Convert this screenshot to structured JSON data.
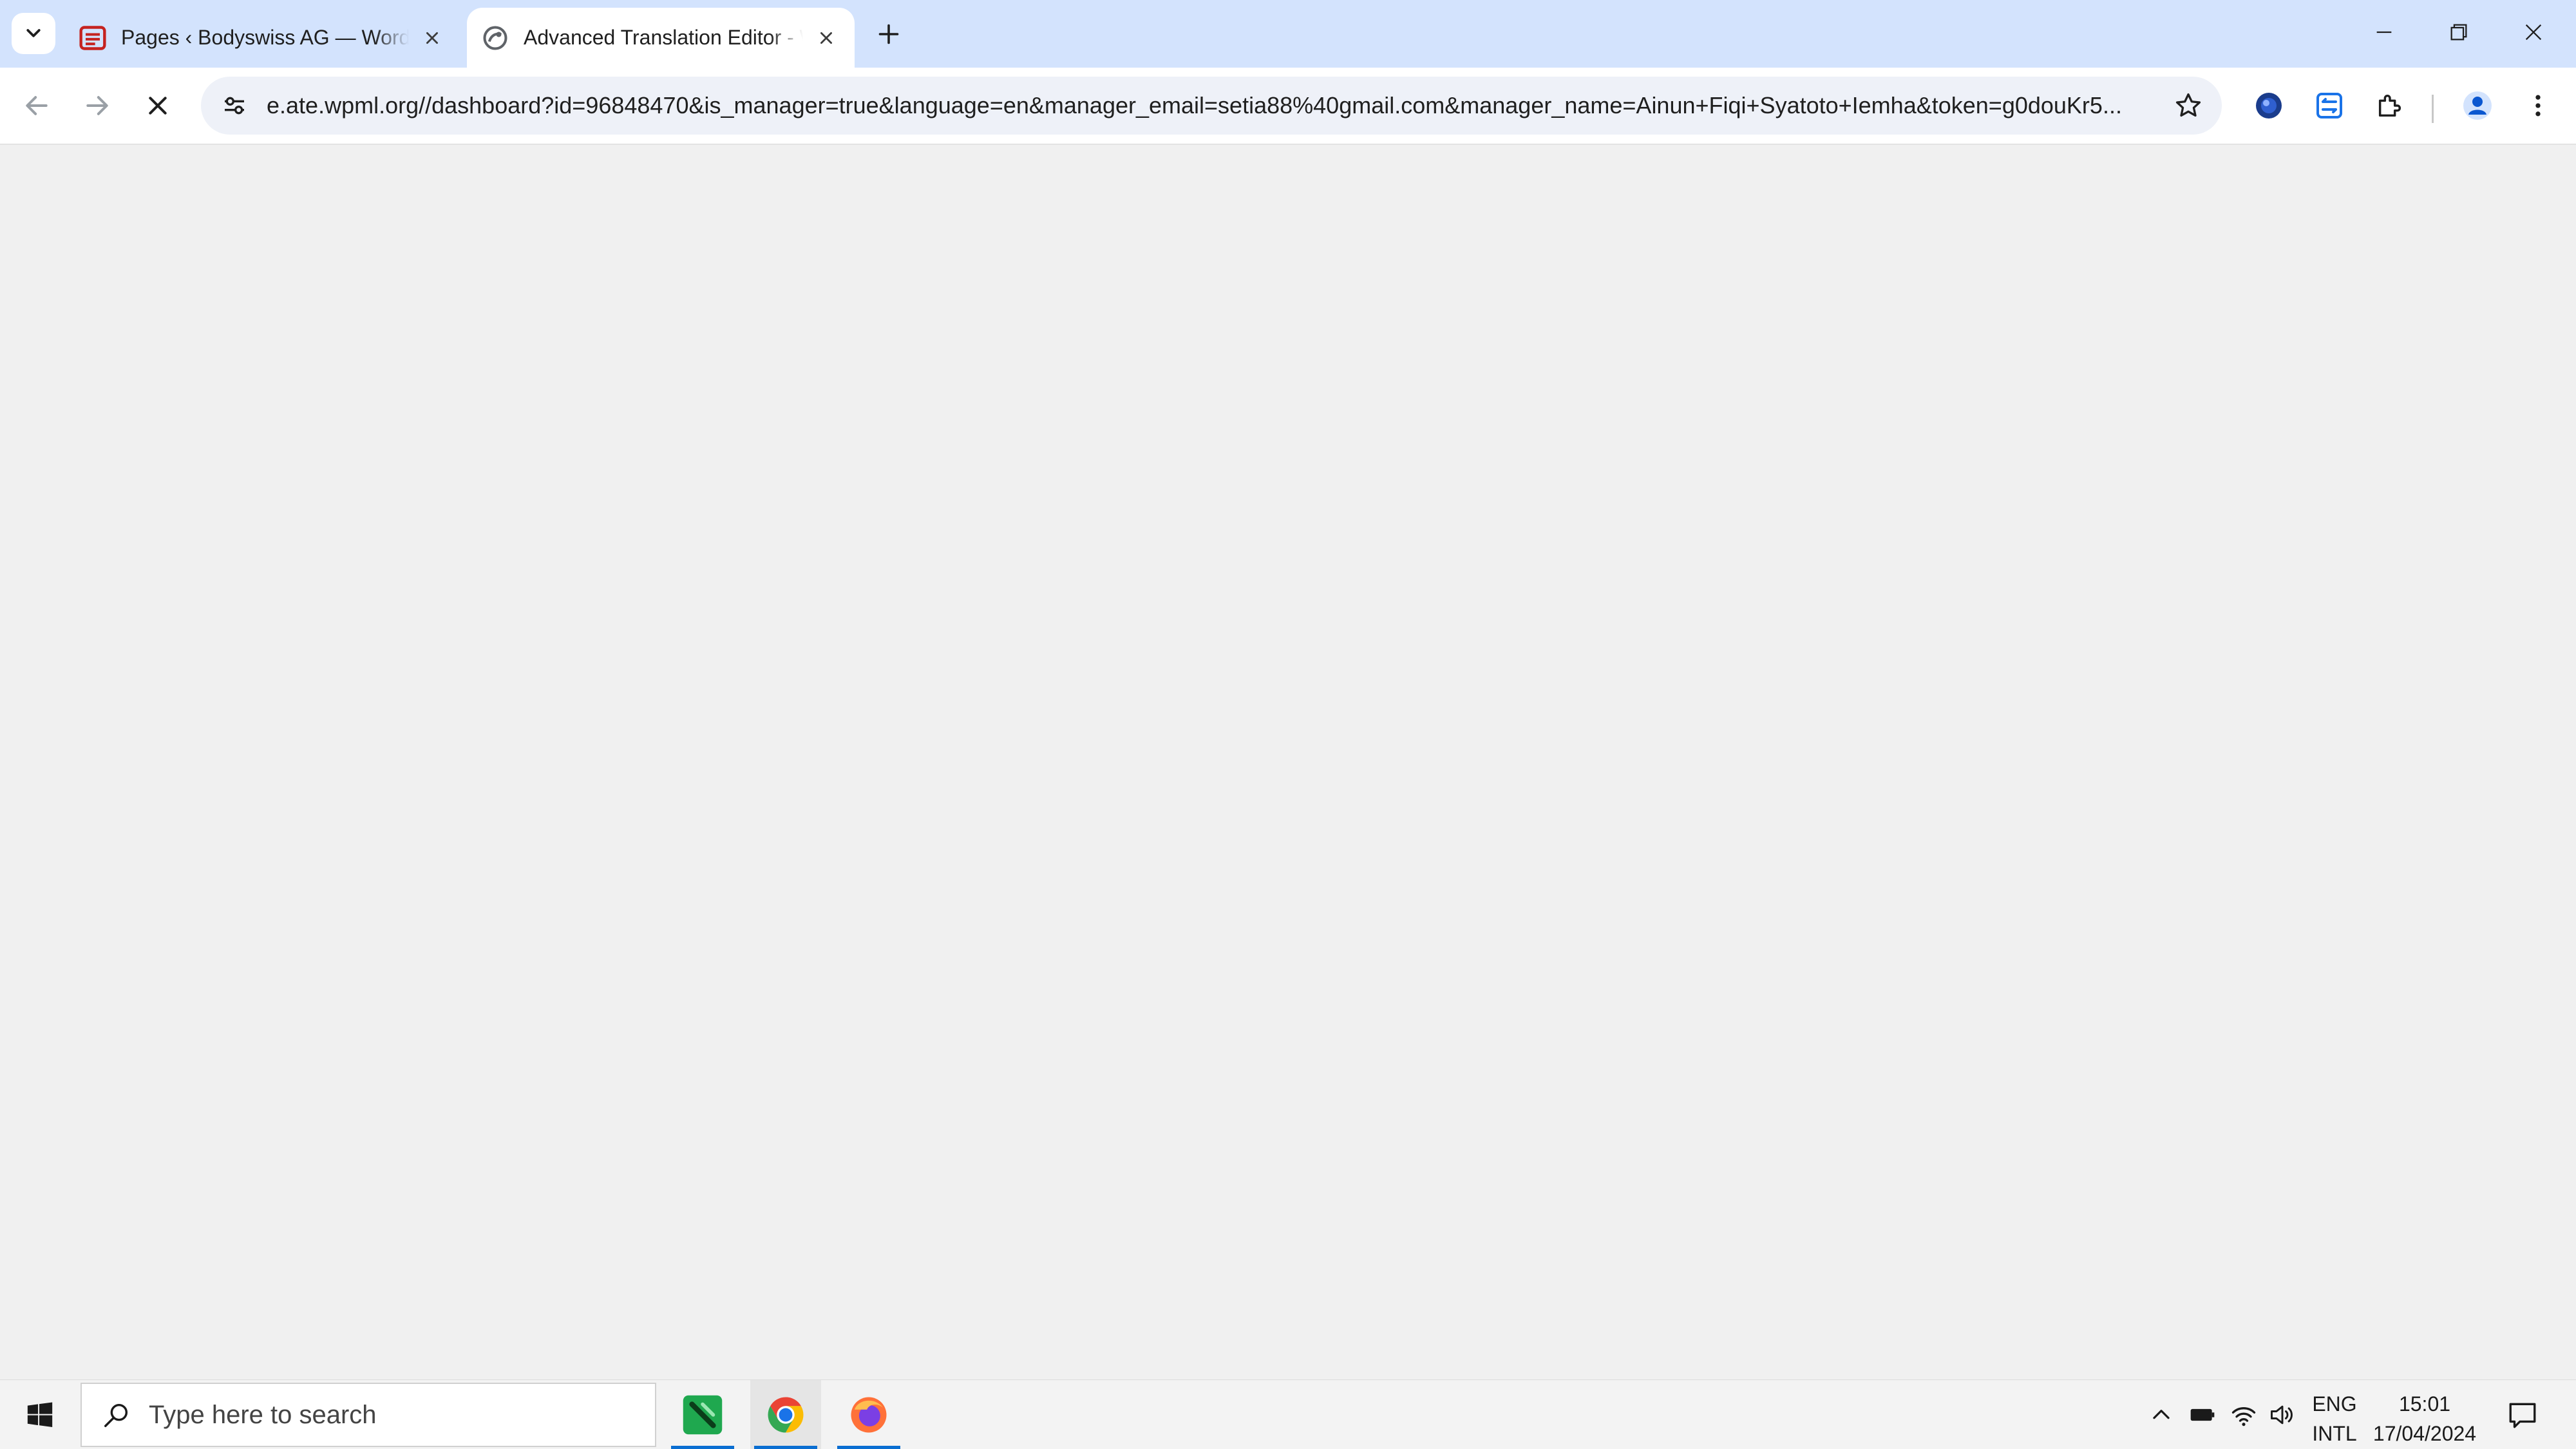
{
  "browser": {
    "tabs": [
      {
        "title": "Pages ‹ Bodyswiss AG — WordPress",
        "favicon": "wordpress-admin-icon",
        "active": false
      },
      {
        "title": "Advanced Translation Editor - WPML",
        "favicon": "wpml-icon",
        "active": true
      }
    ],
    "address_bar": {
      "url": "e.ate.wpml.org//dashboard?id=96848470&is_manager=true&language=en&manager_email=setia88%40gmail.com&manager_name=Ainun+Fiqi+Syatoto+Iemha&token=g0douKr5..."
    },
    "loading": true
  },
  "taskbar": {
    "search_placeholder": "Type here to search",
    "apps": [
      "green-app-icon",
      "chrome-icon",
      "firefox-icon"
    ],
    "language": {
      "line1": "ENG",
      "line2": "INTL"
    },
    "clock": {
      "time": "15:01",
      "date": "17/04/2024"
    }
  },
  "colors": {
    "tabstrip_bg": "#d3e3fd",
    "content_bg": "#f0f0f0",
    "taskbar_bg": "#f3f3f3",
    "accent_underline": "#0a6ed1"
  }
}
